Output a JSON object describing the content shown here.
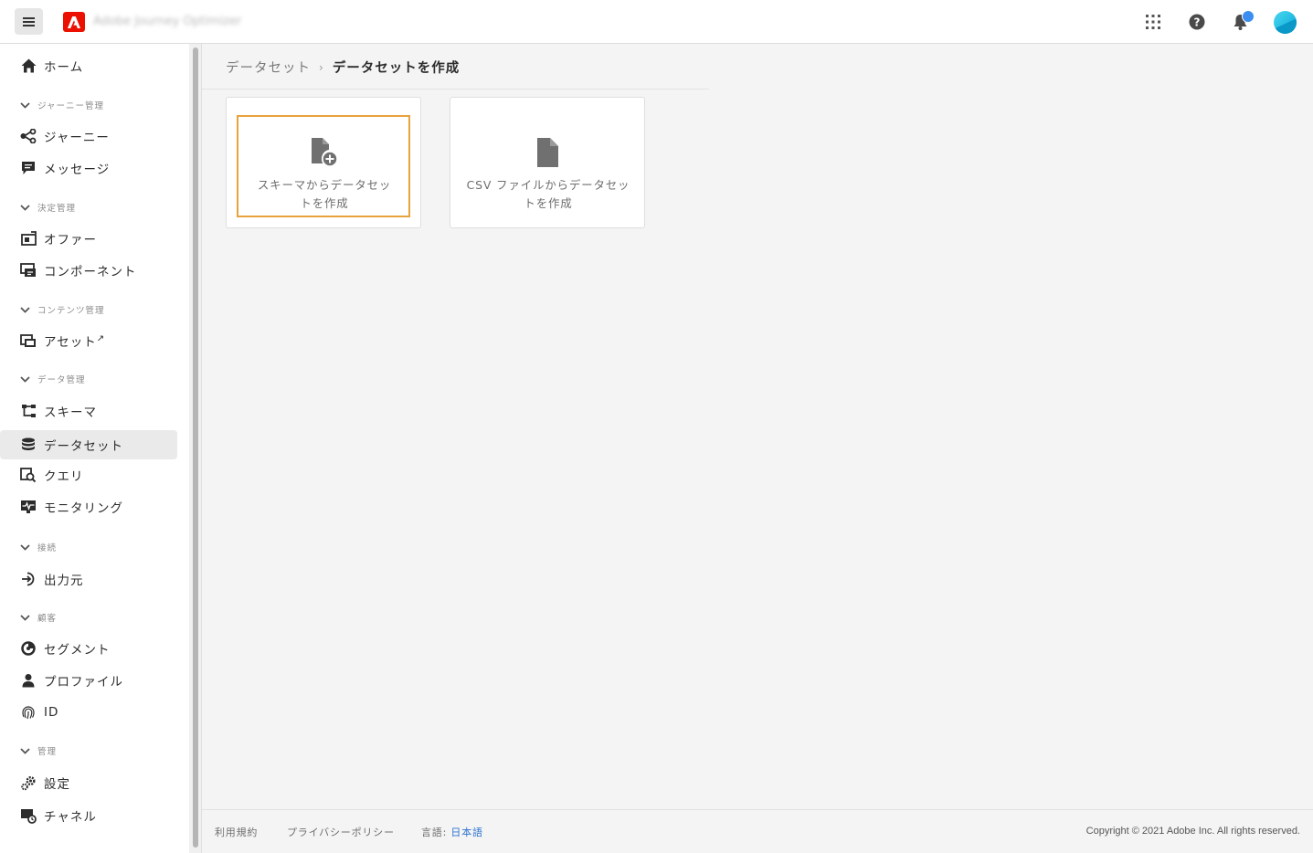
{
  "header": {
    "menu_icon": "hamburger-icon",
    "logo_icon": "adobe-logo-icon",
    "app_title": "Adobe Journey Optimizer",
    "apps_icon": "app-switcher-icon",
    "help_icon": "help-icon",
    "notifications_icon": "bell-icon",
    "avatar_icon": "user-avatar"
  },
  "sidebar": {
    "home": "ホーム",
    "sections": {
      "journey": "ジャーニー管理",
      "decision": "決定管理",
      "content": "コンテンツ管理",
      "data": "データ管理",
      "connections": "接続",
      "customer": "顧客",
      "admin": "管理"
    },
    "items": {
      "journeys": "ジャーニー",
      "messages": "メッセージ",
      "offers": "オファー",
      "components": "コンポーネント",
      "assets": "アセット",
      "schemas": "スキーマ",
      "datasets": "データセット",
      "queries": "クエリ",
      "monitoring": "モニタリング",
      "destinations": "出力元",
      "segments": "セグメント",
      "profiles": "プロファイル",
      "identities": "ID",
      "settings": "設定",
      "channels": "チャネル"
    },
    "active_item": "datasets",
    "accent_color": "#eaeaea"
  },
  "breadcrumb": {
    "parent": "データセット",
    "separator": "›",
    "current": "データセットを作成"
  },
  "cards": [
    {
      "line1": "スキーマからデータセッ",
      "line2": "トを作成",
      "icon": "file-add-icon",
      "selected": true
    },
    {
      "line1": "CSV ファイルからデータセッ",
      "line2": "トを作成",
      "icon": "file-icon",
      "selected": false
    }
  ],
  "footer": {
    "terms": "利用規約",
    "privacy": "プライバシーポリシー",
    "language_label": "言語:",
    "language_value": "日本語",
    "copyright": "Copyright © 2021 Adobe Inc. All rights reserved."
  },
  "colors": {
    "focus_border": "#e8a33c",
    "adobe_red": "#eb1000",
    "link_blue": "#2f74d0",
    "notification_dot": "#3b8ef0"
  }
}
